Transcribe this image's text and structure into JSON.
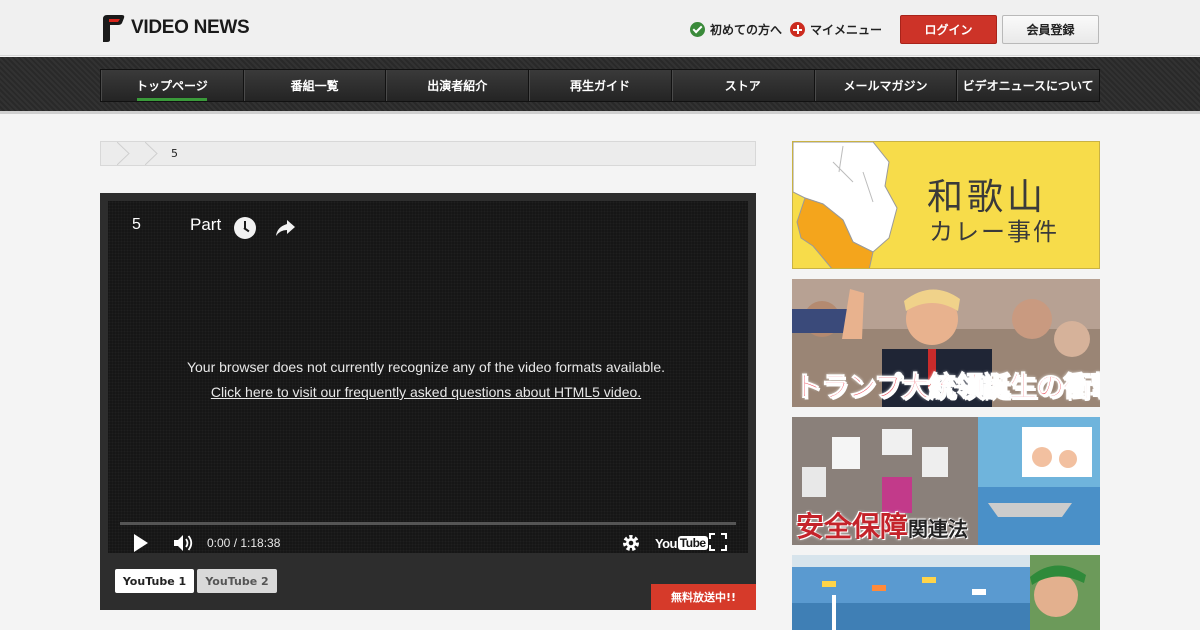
{
  "header": {
    "logo_text": "VIDEO NEWS",
    "first_time_label": "初めての方へ",
    "my_menu_label": "マイメニュー",
    "login_label": "ログイン",
    "register_label": "会員登録"
  },
  "nav": {
    "items": [
      {
        "label": "トップページ",
        "active": true
      },
      {
        "label": "番組一覧"
      },
      {
        "label": "出演者紹介"
      },
      {
        "label": "再生ガイド"
      },
      {
        "label": "ストア"
      },
      {
        "label": "メールマガジン"
      },
      {
        "label": "ビデオニュースについて"
      }
    ]
  },
  "breadcrumb": {
    "current": "5"
  },
  "video": {
    "number": "5",
    "part_label": "Part",
    "error_message": "Your browser does not currently recognize any of the video formats available.",
    "error_link": "Click here to visit our frequently asked questions about HTML5 video.",
    "time": "0:00 / 1:18:38",
    "progress": 0,
    "youtube_logo_you": "You",
    "youtube_logo_tube": "Tube",
    "tabs": [
      {
        "label": "YouTube 1",
        "active": true
      },
      {
        "label": "YouTube 2"
      }
    ],
    "free_badge": "無料放送中!!"
  },
  "sidebar": {
    "banners": [
      {
        "title": "和歌山",
        "subtitle": "カレー事件",
        "color": "#f7dc4a"
      },
      {
        "text": "トランプ大統領誕生の衝撃",
        "color": "#e82a3a"
      },
      {
        "text_main": "安全保障",
        "text_sub": "関連法",
        "color": "#c4232a"
      },
      {}
    ]
  },
  "colors": {
    "accent_red": "#cd3328",
    "nav_bg": "#2b2b2b",
    "active_underline": "#3a9a3a"
  }
}
